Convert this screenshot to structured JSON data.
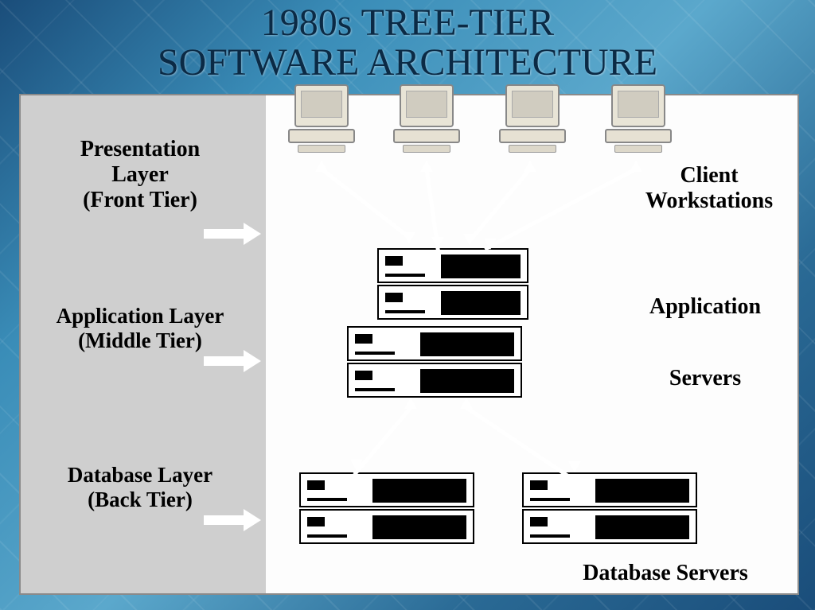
{
  "title": {
    "line1": "1980s TREE-TIER",
    "line2": "SOFTWARE ARCHITECTURE"
  },
  "layers": [
    {
      "name_line1": "Presentation",
      "name_line2": "Layer",
      "name_line3": "(Front Tier)"
    },
    {
      "name_line1": "Application Layer",
      "name_line2": "(Middle Tier)",
      "name_line3": ""
    },
    {
      "name_line1": "Database Layer",
      "name_line2": "(Back Tier)",
      "name_line3": ""
    }
  ],
  "right_labels": {
    "clients_line1": "Client",
    "clients_line2": "Workstations",
    "app_line1": "Application",
    "app_line2": "Servers",
    "db": "Database Servers"
  }
}
